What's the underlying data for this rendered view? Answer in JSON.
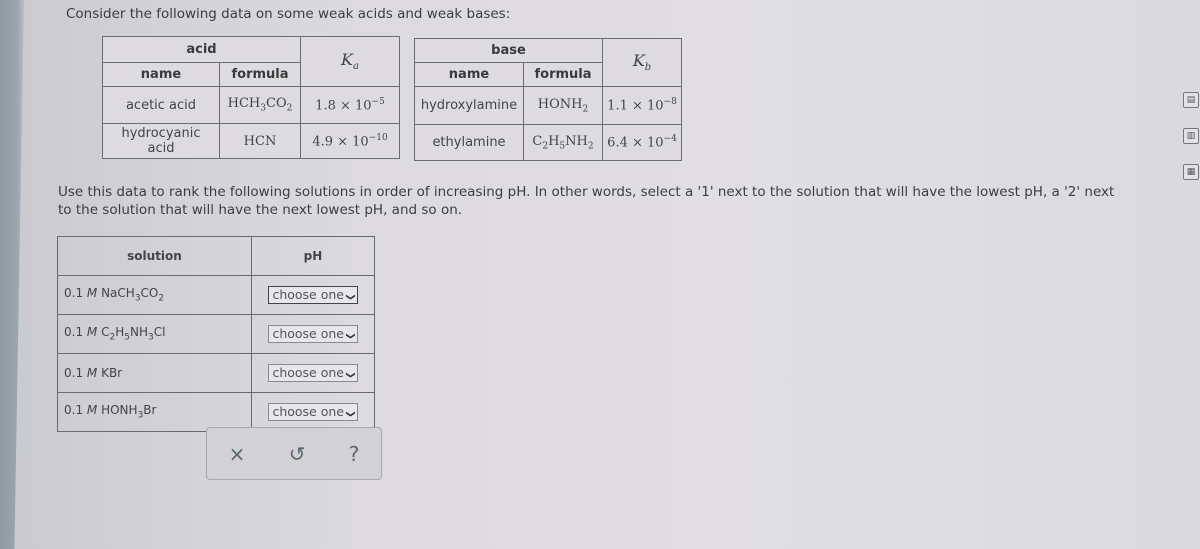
{
  "intro_text": "Consider the following data on some weak acids and weak bases:",
  "acid_table": {
    "group_header": "acid",
    "name_header": "name",
    "formula_header": "formula",
    "k_header": "K",
    "k_sub": "a",
    "rows": [
      {
        "name": "acetic acid",
        "formula_html": "HCH<sub>3</sub>CO<sub>2</sub>",
        "k_mantissa": "1.8 × 10",
        "k_exp": "−5"
      },
      {
        "name": "hydrocyanic acid",
        "formula_html": "HCN",
        "k_mantissa": "4.9 × 10",
        "k_exp": "−10"
      }
    ]
  },
  "base_table": {
    "group_header": "base",
    "name_header": "name",
    "formula_header": "formula",
    "k_header": "K",
    "k_sub": "b",
    "rows": [
      {
        "name": "hydroxylamine",
        "formula_html": "HONH<sub>2</sub>",
        "k_mantissa": "1.1 × 10",
        "k_exp": "−8"
      },
      {
        "name": "ethylamine",
        "formula_html": "C<sub>2</sub>H<sub>5</sub>NH<sub>2</sub>",
        "k_mantissa": "6.4 × 10",
        "k_exp": "−4"
      }
    ]
  },
  "instruction_text": "Use this data to rank the following solutions in order of increasing pH. In other words, select a '1' next to the solution that will have the lowest pH, a '2' next to the solution that will have the next lowest pH, and so on.",
  "solution_table": {
    "solution_header": "solution",
    "ph_header": "pH",
    "rows": [
      {
        "solution_html": "0.1 <i>M</i> NaCH<sub>3</sub>CO<sub>2</sub>",
        "selected": "choose one"
      },
      {
        "solution_html": "0.1 <i>M</i> C<sub>2</sub>H<sub>5</sub>NH<sub>3</sub>Cl",
        "selected": "choose one"
      },
      {
        "solution_html": "0.1 <i>M</i> KBr",
        "selected": "choose one"
      },
      {
        "solution_html": "0.1 <i>M</i> HONH<sub>3</sub>Br",
        "selected": "choose one"
      }
    ]
  },
  "actions": {
    "clear_icon": "×",
    "undo_icon": "↺",
    "help_icon": "?"
  },
  "side_tools": [
    "calculator-icon",
    "chart-icon",
    "periodic-table-icon"
  ]
}
